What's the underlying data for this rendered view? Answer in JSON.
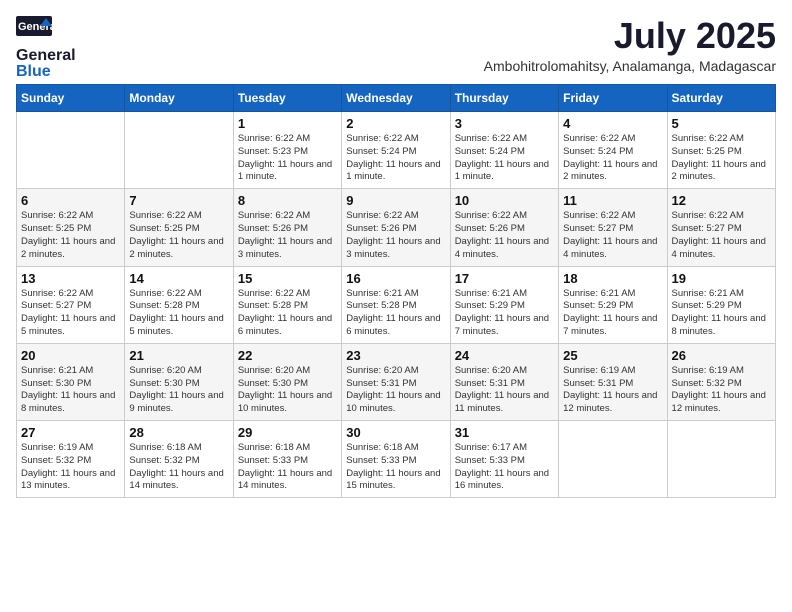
{
  "logo": {
    "general": "General",
    "blue": "Blue"
  },
  "title": "July 2025",
  "subtitle": "Ambohitrolomahitsy, Analamanga, Madagascar",
  "headers": [
    "Sunday",
    "Monday",
    "Tuesday",
    "Wednesday",
    "Thursday",
    "Friday",
    "Saturday"
  ],
  "weeks": [
    [
      {
        "day": "",
        "info": ""
      },
      {
        "day": "",
        "info": ""
      },
      {
        "day": "1",
        "info": "Sunrise: 6:22 AM\nSunset: 5:23 PM\nDaylight: 11 hours and 1 minute."
      },
      {
        "day": "2",
        "info": "Sunrise: 6:22 AM\nSunset: 5:24 PM\nDaylight: 11 hours and 1 minute."
      },
      {
        "day": "3",
        "info": "Sunrise: 6:22 AM\nSunset: 5:24 PM\nDaylight: 11 hours and 1 minute."
      },
      {
        "day": "4",
        "info": "Sunrise: 6:22 AM\nSunset: 5:24 PM\nDaylight: 11 hours and 2 minutes."
      },
      {
        "day": "5",
        "info": "Sunrise: 6:22 AM\nSunset: 5:25 PM\nDaylight: 11 hours and 2 minutes."
      }
    ],
    [
      {
        "day": "6",
        "info": "Sunrise: 6:22 AM\nSunset: 5:25 PM\nDaylight: 11 hours and 2 minutes."
      },
      {
        "day": "7",
        "info": "Sunrise: 6:22 AM\nSunset: 5:25 PM\nDaylight: 11 hours and 2 minutes."
      },
      {
        "day": "8",
        "info": "Sunrise: 6:22 AM\nSunset: 5:26 PM\nDaylight: 11 hours and 3 minutes."
      },
      {
        "day": "9",
        "info": "Sunrise: 6:22 AM\nSunset: 5:26 PM\nDaylight: 11 hours and 3 minutes."
      },
      {
        "day": "10",
        "info": "Sunrise: 6:22 AM\nSunset: 5:26 PM\nDaylight: 11 hours and 4 minutes."
      },
      {
        "day": "11",
        "info": "Sunrise: 6:22 AM\nSunset: 5:27 PM\nDaylight: 11 hours and 4 minutes."
      },
      {
        "day": "12",
        "info": "Sunrise: 6:22 AM\nSunset: 5:27 PM\nDaylight: 11 hours and 4 minutes."
      }
    ],
    [
      {
        "day": "13",
        "info": "Sunrise: 6:22 AM\nSunset: 5:27 PM\nDaylight: 11 hours and 5 minutes."
      },
      {
        "day": "14",
        "info": "Sunrise: 6:22 AM\nSunset: 5:28 PM\nDaylight: 11 hours and 5 minutes."
      },
      {
        "day": "15",
        "info": "Sunrise: 6:22 AM\nSunset: 5:28 PM\nDaylight: 11 hours and 6 minutes."
      },
      {
        "day": "16",
        "info": "Sunrise: 6:21 AM\nSunset: 5:28 PM\nDaylight: 11 hours and 6 minutes."
      },
      {
        "day": "17",
        "info": "Sunrise: 6:21 AM\nSunset: 5:29 PM\nDaylight: 11 hours and 7 minutes."
      },
      {
        "day": "18",
        "info": "Sunrise: 6:21 AM\nSunset: 5:29 PM\nDaylight: 11 hours and 7 minutes."
      },
      {
        "day": "19",
        "info": "Sunrise: 6:21 AM\nSunset: 5:29 PM\nDaylight: 11 hours and 8 minutes."
      }
    ],
    [
      {
        "day": "20",
        "info": "Sunrise: 6:21 AM\nSunset: 5:30 PM\nDaylight: 11 hours and 8 minutes."
      },
      {
        "day": "21",
        "info": "Sunrise: 6:20 AM\nSunset: 5:30 PM\nDaylight: 11 hours and 9 minutes."
      },
      {
        "day": "22",
        "info": "Sunrise: 6:20 AM\nSunset: 5:30 PM\nDaylight: 11 hours and 10 minutes."
      },
      {
        "day": "23",
        "info": "Sunrise: 6:20 AM\nSunset: 5:31 PM\nDaylight: 11 hours and 10 minutes."
      },
      {
        "day": "24",
        "info": "Sunrise: 6:20 AM\nSunset: 5:31 PM\nDaylight: 11 hours and 11 minutes."
      },
      {
        "day": "25",
        "info": "Sunrise: 6:19 AM\nSunset: 5:31 PM\nDaylight: 11 hours and 12 minutes."
      },
      {
        "day": "26",
        "info": "Sunrise: 6:19 AM\nSunset: 5:32 PM\nDaylight: 11 hours and 12 minutes."
      }
    ],
    [
      {
        "day": "27",
        "info": "Sunrise: 6:19 AM\nSunset: 5:32 PM\nDaylight: 11 hours and 13 minutes."
      },
      {
        "day": "28",
        "info": "Sunrise: 6:18 AM\nSunset: 5:32 PM\nDaylight: 11 hours and 14 minutes."
      },
      {
        "day": "29",
        "info": "Sunrise: 6:18 AM\nSunset: 5:33 PM\nDaylight: 11 hours and 14 minutes."
      },
      {
        "day": "30",
        "info": "Sunrise: 6:18 AM\nSunset: 5:33 PM\nDaylight: 11 hours and 15 minutes."
      },
      {
        "day": "31",
        "info": "Sunrise: 6:17 AM\nSunset: 5:33 PM\nDaylight: 11 hours and 16 minutes."
      },
      {
        "day": "",
        "info": ""
      },
      {
        "day": "",
        "info": ""
      }
    ]
  ]
}
